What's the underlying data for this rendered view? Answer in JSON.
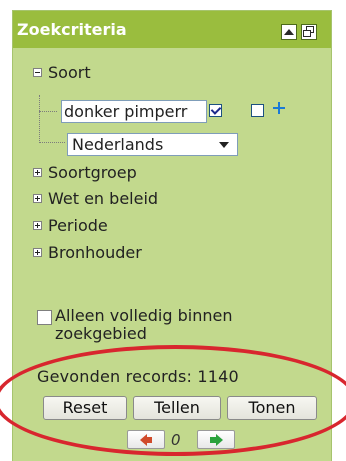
{
  "panel": {
    "title": "Zoekcriteria",
    "header_icons": [
      "collapse-up-icon",
      "restore-window-icon"
    ]
  },
  "tree": {
    "soort": {
      "label": "Soort",
      "expanded": true,
      "species_input_value": "donker pimperr",
      "checkbox_1_checked": true,
      "checkbox_2_checked": false,
      "add_icon": "plus-icon",
      "language_select_value": "Nederlands"
    },
    "collapsed_items": [
      {
        "label": "Soortgroep"
      },
      {
        "label": "Wet en beleid"
      },
      {
        "label": "Periode"
      },
      {
        "label": "Bronhouder"
      }
    ]
  },
  "full_area": {
    "label": "Alleen volledig binnen zoekgebied",
    "checked": false
  },
  "records": {
    "text": "Gevonden records:",
    "count": "1140"
  },
  "buttons": {
    "reset": "Reset",
    "tellen": "Tellen",
    "tonen": "Tonen"
  },
  "pager": {
    "count": "0",
    "prev_icon": "arrow-left-icon",
    "next_icon": "arrow-right-icon"
  },
  "colors": {
    "panel_bg": "#c2d98d",
    "header_bg": "#9abd3e",
    "annotation": "#d8262e"
  }
}
